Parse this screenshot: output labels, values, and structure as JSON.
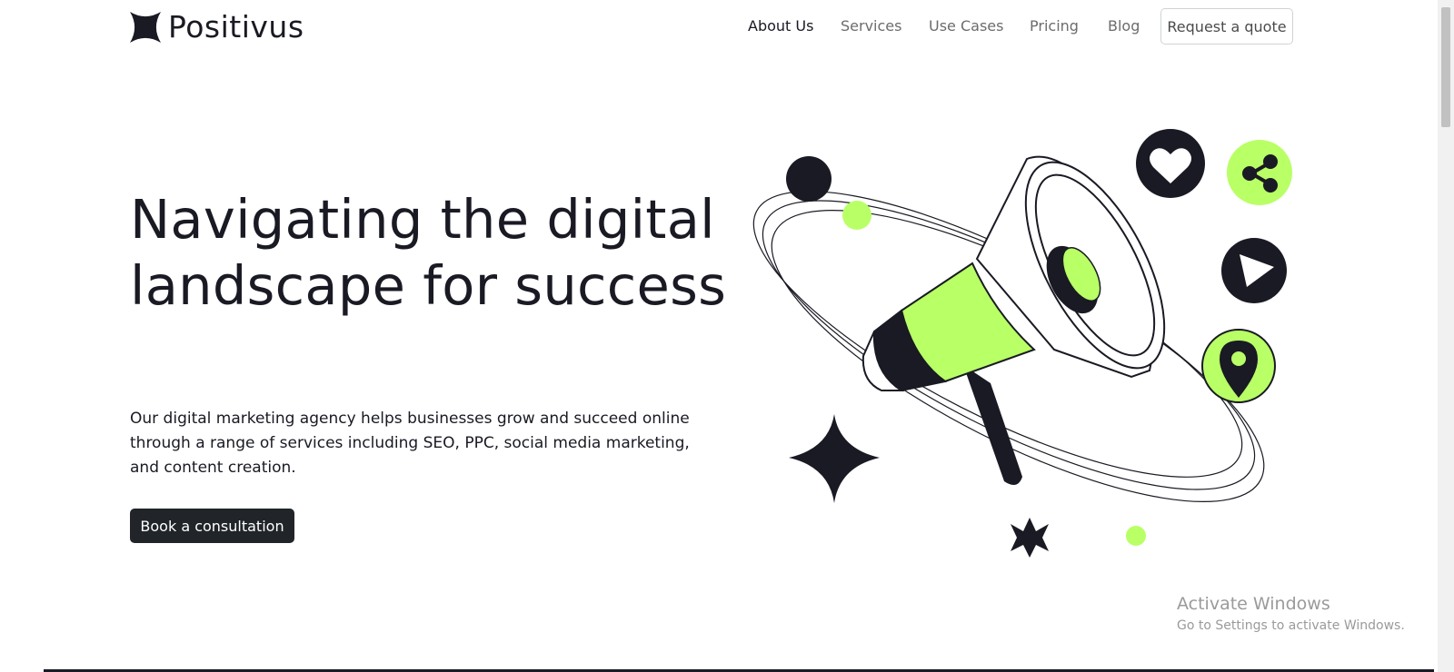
{
  "brand": {
    "name": "Positivus",
    "logo_icon": "four-point-star-icon"
  },
  "nav": {
    "items": [
      {
        "label": "About Us",
        "active": true
      },
      {
        "label": "Services",
        "active": false
      },
      {
        "label": "Use Cases",
        "active": false
      },
      {
        "label": "Pricing",
        "active": false
      },
      {
        "label": "Blog",
        "active": false
      }
    ],
    "quote_label": "Request a quote"
  },
  "hero": {
    "title": "Navigating the digital landscape for success",
    "description": "Our digital marketing agency helps businesses grow and succeed online through a range of services including SEO, PPC, social media marketing, and content creation.",
    "cta_label": "Book a consultation",
    "illustration_icons": [
      "megaphone-icon",
      "heart-icon",
      "share-icon",
      "play-icon",
      "location-pin-icon",
      "sparkle-star-icon"
    ]
  },
  "colors": {
    "accent_green": "#B9FF66",
    "dark": "#191A23",
    "button_dark": "#212529",
    "nav_inactive": "#6c6c6c"
  },
  "watermark": {
    "title": "Activate Windows",
    "subtitle": "Go to Settings to activate Windows."
  }
}
